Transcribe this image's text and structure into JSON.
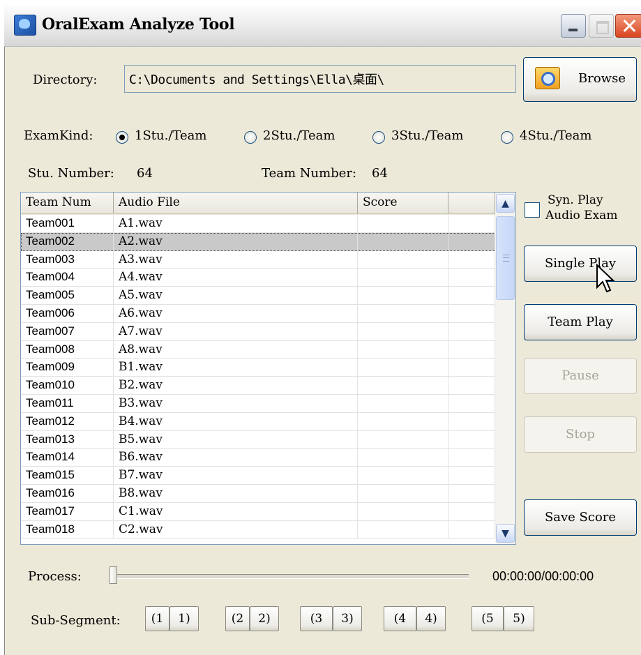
{
  "window": {
    "title": "OralExam Analyze Tool"
  },
  "directory": {
    "label": "Directory:",
    "value": "C:\\Documents and Settings\\Ella\\桌面\\"
  },
  "browse_label": "Browse",
  "examkind": {
    "label": "ExamKind:",
    "options": [
      "1Stu./Team",
      "2Stu./Team",
      "3Stu./Team",
      "4Stu./Team"
    ],
    "selected": "1Stu./Team"
  },
  "counts": {
    "stu_label": "Stu. Number:",
    "stu_value": "64",
    "team_label": "Team Number:",
    "team_value": "64"
  },
  "table": {
    "columns": [
      "Team Num",
      "Audio File",
      "Score",
      ""
    ],
    "selected_row": 1,
    "rows": [
      [
        "Team001",
        "A1.wav"
      ],
      [
        "Team002",
        "A2.wav"
      ],
      [
        "Team003",
        "A3.wav"
      ],
      [
        "Team004",
        "A4.wav"
      ],
      [
        "Team005",
        "A5.wav"
      ],
      [
        "Team006",
        "A6.wav"
      ],
      [
        "Team007",
        "A7.wav"
      ],
      [
        "Team008",
        "A8.wav"
      ],
      [
        "Team009",
        "B1.wav"
      ],
      [
        "Team010",
        "B2.wav"
      ],
      [
        "Team011",
        "B3.wav"
      ],
      [
        "Team012",
        "B4.wav"
      ],
      [
        "Team013",
        "B5.wav"
      ],
      [
        "Team014",
        "B6.wav"
      ],
      [
        "Team015",
        "B7.wav"
      ],
      [
        "Team016",
        "B8.wav"
      ],
      [
        "Team017",
        "C1.wav"
      ],
      [
        "Team018",
        "C2.wav"
      ]
    ]
  },
  "syn_play": {
    "line1": "Syn. Play",
    "line2": "Audio Exam",
    "checked": false
  },
  "buttons": {
    "single_play": "Single Play",
    "team_play": "Team Play",
    "pause": "Pause",
    "stop": "Stop",
    "save_score": "Save Score"
  },
  "process": {
    "label": "Process:",
    "time": "00:00:00/00:00:00",
    "position": 0
  },
  "subsegment": {
    "label": "Sub-Segment:",
    "groups": [
      [
        "(1",
        "1)"
      ],
      [
        "(2",
        "2)"
      ],
      [
        "(3",
        "3)"
      ],
      [
        "(4",
        "4)"
      ],
      [
        "(5",
        "5)"
      ]
    ]
  }
}
